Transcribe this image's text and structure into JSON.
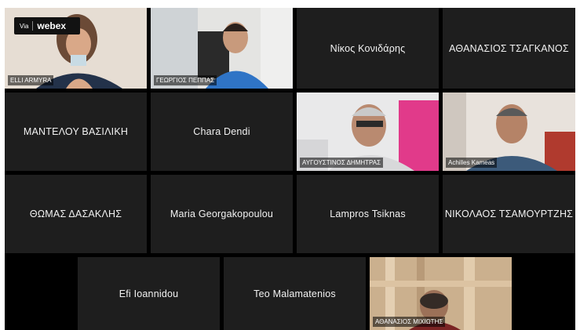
{
  "branding": {
    "via": "Via",
    "brand": "webex"
  },
  "participants": [
    {
      "name": "ELLI ARMYRA",
      "video": true
    },
    {
      "name": "ΓΕΩΡΓΙΟΣ ΠΕΠΠΑΣ",
      "video": true
    },
    {
      "name": "Νίκος Κονιδάρης",
      "video": false
    },
    {
      "name": "ΑΘΑΝΑΣΙΟΣ ΤΣΑΓΚΑΝΟΣ",
      "video": false
    },
    {
      "name": "ΜΑΝΤΕΛΟΥ ΒΑΣΙΛΙΚΗ",
      "video": false
    },
    {
      "name": "Chara Dendi",
      "video": false
    },
    {
      "name": "ΑΥΓΟΥΣΤΙΝΟΣ ΔΗΜΗΤΡΑΣ",
      "video": true
    },
    {
      "name": "Achilles Kameas",
      "video": true
    },
    {
      "name": "ΘΩΜΑΣ ΔΑΣΑΚΛΗΣ",
      "video": false
    },
    {
      "name": "Maria Georgakopoulou",
      "video": false
    },
    {
      "name": "Lampros Tsiknas",
      "video": false
    },
    {
      "name": "ΝΙΚΟΛΑΟΣ ΤΣΑΜΟΥΡΤΖΗΣ",
      "video": false
    },
    {
      "name": "Efi Ioannidou",
      "video": false
    },
    {
      "name": "Teo Malamatenios",
      "video": false
    },
    {
      "name": "ΑΘΑΝΑΣΙΟΣ ΜΙΧΙΩΤΗΣ",
      "video": true
    }
  ]
}
